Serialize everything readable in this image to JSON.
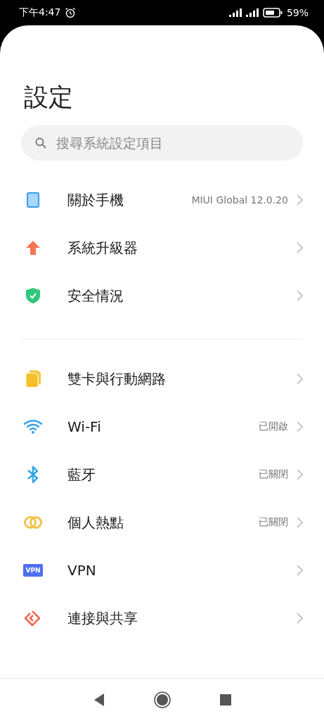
{
  "status_bar": {
    "time": "下午4:47",
    "battery": "59%"
  },
  "title": "設定",
  "search": {
    "placeholder": "搜尋系統設定項目"
  },
  "sections": [
    {
      "items": [
        {
          "kind": "phone",
          "label": "關於手機",
          "value": "MIUI Global 12.0.20"
        },
        {
          "kind": "update",
          "label": "系統升級器"
        },
        {
          "kind": "shield",
          "label": "安全情況"
        }
      ]
    },
    {
      "items": [
        {
          "kind": "sim",
          "label": "雙卡與行動網路"
        },
        {
          "kind": "wifi",
          "label": "Wi-Fi",
          "value": "已開啟"
        },
        {
          "kind": "bluetooth",
          "label": "藍牙",
          "value": "已關閉"
        },
        {
          "kind": "hotspot",
          "label": "個人熱點",
          "value": "已關閉"
        },
        {
          "kind": "vpn",
          "label": "VPN",
          "icon_text": "VPN"
        },
        {
          "kind": "share",
          "label": "連接與共享"
        }
      ]
    }
  ]
}
